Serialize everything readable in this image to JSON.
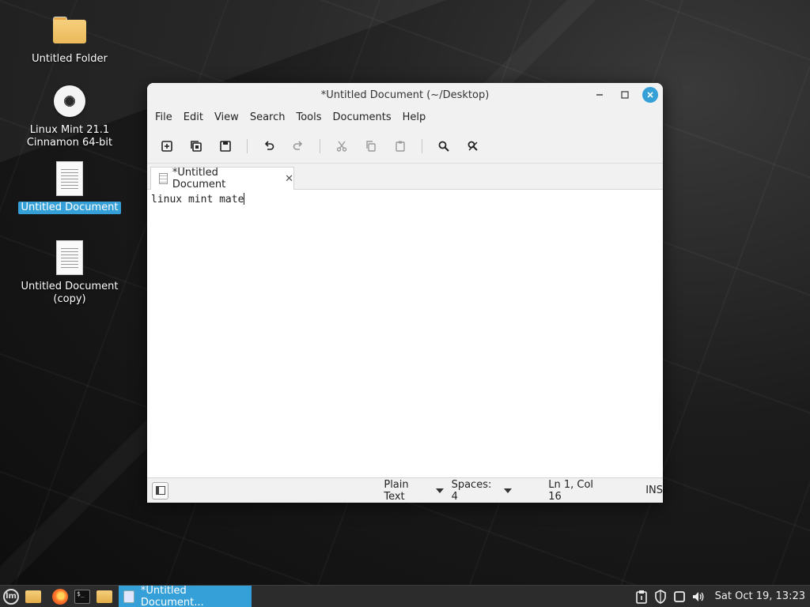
{
  "desktop": {
    "icons": [
      {
        "label": "Untitled Folder",
        "icon": "folder-icon"
      },
      {
        "label": "Linux Mint 21.1\nCinnamon 64-bit",
        "line1": "Linux Mint 21.1",
        "line2": "Cinnamon 64-bit",
        "icon": "disc-icon"
      },
      {
        "label": "Untitled Document",
        "icon": "text-document-icon",
        "selected": true
      },
      {
        "label": "Untitled Document (copy)",
        "line1": "Untitled Document",
        "line2": "(copy)",
        "icon": "text-document-icon"
      }
    ]
  },
  "window": {
    "title": "*Untitled Document (~/Desktop)",
    "menu": [
      "File",
      "Edit",
      "View",
      "Search",
      "Tools",
      "Documents",
      "Help"
    ],
    "toolbar": [
      "new-document-icon",
      "open-document-icon",
      "save-icon",
      "undo-icon",
      "redo-icon",
      "cut-icon",
      "copy-icon",
      "paste-icon",
      "search-icon",
      "search-replace-icon"
    ],
    "tab_label": "*Untitled Document",
    "content": "linux mint mate",
    "status": {
      "language": "Plain Text",
      "spaces": "Spaces: 4",
      "position": "Ln 1, Col 16",
      "mode": "INS"
    }
  },
  "taskbar": {
    "window_label": "*Untitled Document...",
    "clock": "Sat Oct 19, 13:23"
  },
  "colors": {
    "accent": "#35a0d8",
    "taskbar": "#2c2c2c"
  }
}
